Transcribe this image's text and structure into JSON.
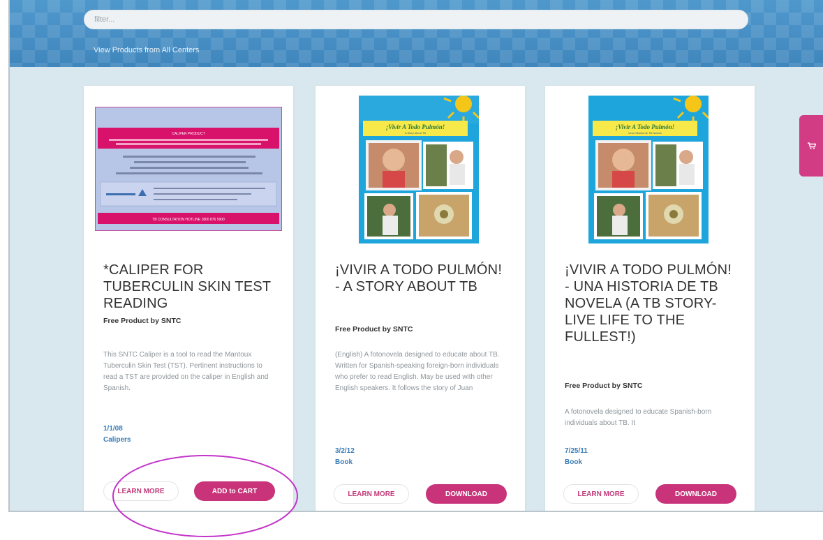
{
  "search": {
    "placeholder": "filter..."
  },
  "header": {
    "view_all_link": "View Products from All Centers"
  },
  "products": [
    {
      "title": "*CALIPER FOR TUBERCULIN SKIN TEST READING",
      "by": "Free Product by SNTC",
      "description": "This SNTC Caliper is a tool to read the Mantoux Tuberculin Skin Test (TST). Pertinent instructions to read a TST are provided on the caliper in English and Spanish.",
      "date": "1/1/08",
      "type": "Calipers",
      "learn_more": "LEARN MORE",
      "action": "ADD to CART"
    },
    {
      "title": "¡VIVIR A TODO PULMÓN! - A STORY ABOUT TB",
      "by": "Free Product by SNTC",
      "description": "(English) A fotonovela designed to educate about TB. Written for Spanish-speaking foreign-born individuals who prefer to read English. May be used with other English speakers. It follows the story of Juan",
      "date": "3/2/12",
      "type": "Book",
      "learn_more": "LEARN MORE",
      "action": "DOWNLOAD",
      "cover_title": "¡Vivir A Todo Pulmón!",
      "cover_subtitle": "A Story about TB"
    },
    {
      "title": "¡VIVIR A TODO PULMÓN! - UNA HISTORIA DE TB NOVELA (A TB STORY- LIVE LIFE TO THE FULLEST!)",
      "by": "Free Product by SNTC",
      "description": "A fotonovela designed to educate Spanish-born individuals about TB. It",
      "date": "7/25/11",
      "type": "Book",
      "learn_more": "LEARN MORE",
      "action": "DOWNLOAD",
      "cover_title": "¡Vivir A Todo Pulmón!",
      "cover_subtitle": "Una Historia de TB Novela"
    }
  ],
  "caliper_card": {
    "banner_top": "CALIPER PRODUCT",
    "banner_bottom": "TB CONSULTATION HOTLINE 1800 876 5900"
  },
  "colors": {
    "brand_pink": "#c8337a",
    "header_blue": "#4a93c8",
    "link_blue": "#3a7cb6",
    "page_bg": "#d9e7ef",
    "highlight": "#c233c9"
  },
  "icons": {
    "cart": "shopping-cart-icon"
  }
}
